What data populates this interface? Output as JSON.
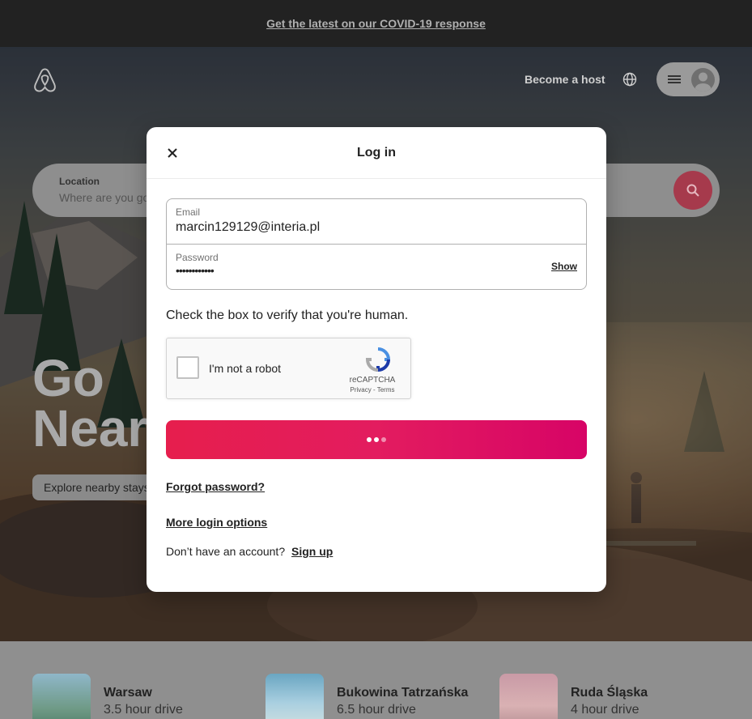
{
  "banner": {
    "link_text": "Get the latest on our COVID-19 response"
  },
  "header": {
    "become_host": "Become a host",
    "logo_icon": "airbnb-logo-icon",
    "globe_icon": "globe-icon",
    "menu_icon": "hamburger-menu-icon"
  },
  "search": {
    "location_label": "Location",
    "location_placeholder": "Where are you going?",
    "search_icon": "search-icon"
  },
  "hero": {
    "title_line1": "Go",
    "title_line2": "Near",
    "explore_label": "Explore nearby stays"
  },
  "cards": [
    {
      "name": "Warsaw",
      "distance": "3.5 hour drive"
    },
    {
      "name": "Bukowina Tatrzańska",
      "distance": "6.5 hour drive"
    },
    {
      "name": "Ruda Śląska",
      "distance": "4 hour drive"
    }
  ],
  "modal": {
    "title": "Log in",
    "close_icon": "close-icon",
    "email_label": "Email",
    "email_value": "marcin129129@interia.pl",
    "password_label": "Password",
    "password_value": "••••••••••••",
    "show_label": "Show",
    "verify_text": "Check the box to verify that you're human.",
    "captcha_label": "I'm not a robot",
    "captcha_brand": "reCAPTCHA",
    "captcha_links": "Privacy - Terms",
    "forgot_label": "Forgot password?",
    "more_options_label": "More login options",
    "no_account_text": "Don’t have an account?",
    "signup_label": "Sign up"
  },
  "colors": {
    "brand": "#e61e4d",
    "brand_end": "#d70466",
    "banner_bg": "#222222"
  }
}
